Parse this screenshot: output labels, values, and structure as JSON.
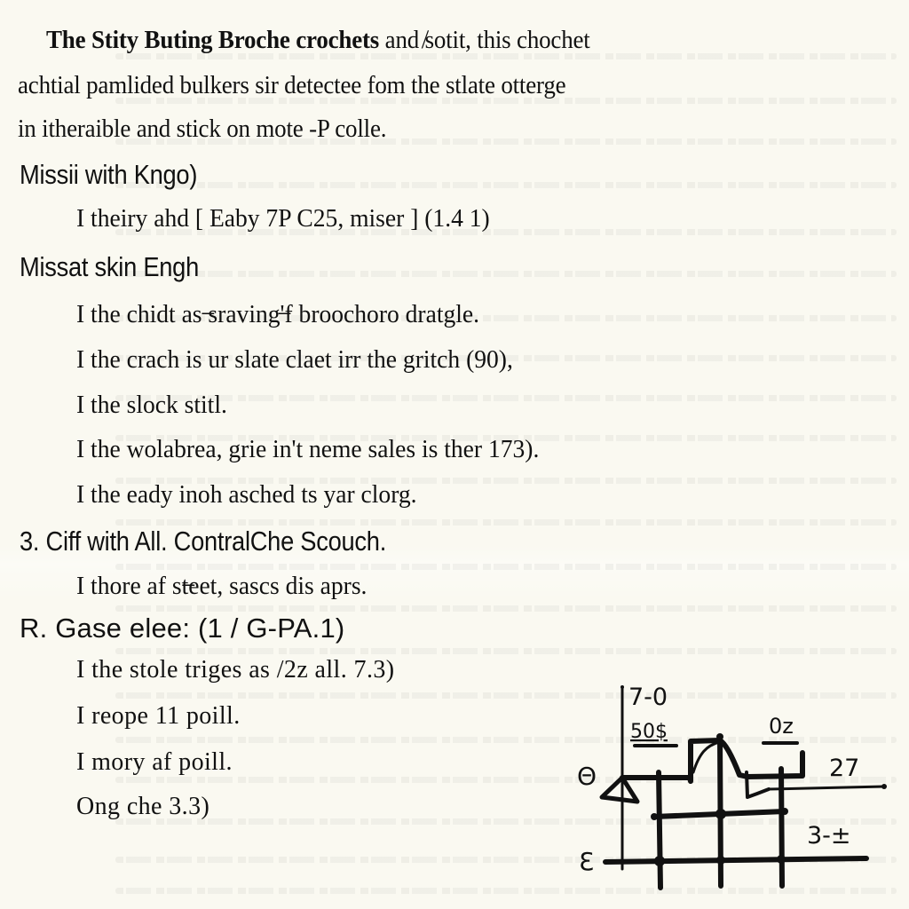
{
  "intro": {
    "bold_text": "The Stity Buting Broche crochets",
    "line1_rest": " and ̸sotit, this chochet",
    "line2": "achtial pamlided bulkers sir detectee fom the stlate otterge",
    "line3": "in itheraible and stick on mote -P colle."
  },
  "sections": [
    {
      "heading": "Missii with Kngo)",
      "items": [
        "I theiry ahd [ Eaby 7P C25, miser ] (1.4 1)"
      ]
    },
    {
      "heading": "Missat skin Engh",
      "items": [
        "I the chidt as ̶sraving'̶f broochoro dratgle.",
        "I the crach is ur slate claet irr the gritch (90),",
        "I the slock stitl.",
        "I the wolabrea, grie in't neme sales is ther 173).",
        "I the eady inoh asched ts yar clorg."
      ]
    },
    {
      "heading": "3. Ciff with All. ContralChe Scouch.",
      "items": [
        "I thore af st̶eet, sascs dis aprs."
      ]
    },
    {
      "heading": "R. Gase elee: (1 / G-PA.1)",
      "items": [
        "I the stole triges as /2z all. 7.3)",
        "I reope 11 poill.",
        "I mory af poill.",
        "Ong che 3.3)"
      ]
    }
  ],
  "diagram": {
    "labels": {
      "top": "7-0",
      "left_upper": "50$",
      "right_upper": "0z",
      "right_mid": "27",
      "right_lower": "3-±",
      "axis_left_top": "Θ",
      "axis_left_bottom": "Ɛ"
    }
  }
}
